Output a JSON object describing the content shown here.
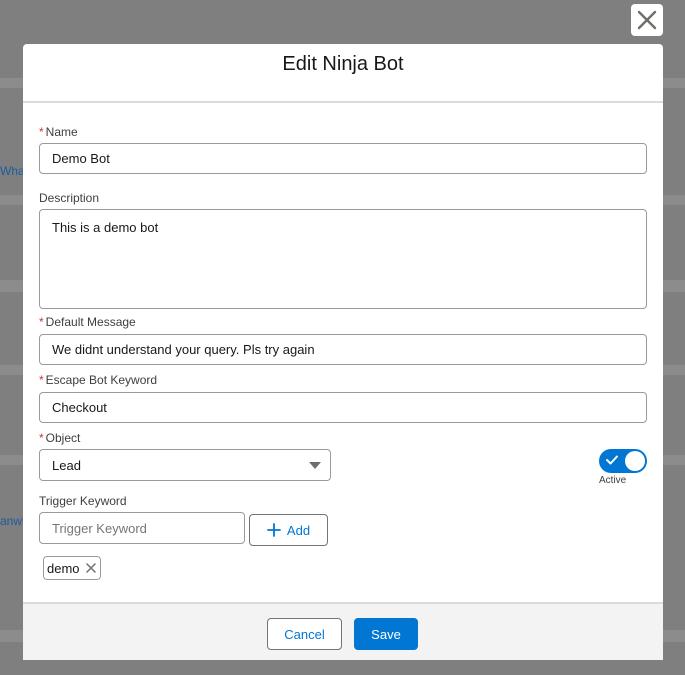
{
  "background": {
    "link_1": "Wha",
    "link_2": "anwh"
  },
  "modal": {
    "title": "Edit Ninja Bot",
    "close_icon": "close-icon"
  },
  "form": {
    "name": {
      "label": "Name",
      "value": "Demo Bot",
      "required": "*"
    },
    "description": {
      "label": "Description",
      "value": "This is a demo bot"
    },
    "default_message": {
      "label": "Default Message",
      "value": "We didnt understand your query. Pls try again",
      "required": "*"
    },
    "escape_keyword": {
      "label": "Escape Bot Keyword",
      "value": "Checkout",
      "required": "*"
    },
    "object": {
      "label": "Object",
      "value": "Lead",
      "required": "*"
    },
    "active": {
      "label": "Active",
      "checked": true
    },
    "trigger_keyword": {
      "label": "Trigger Keyword",
      "placeholder": "Trigger Keyword",
      "add_label": "Add"
    },
    "keywords": [
      "demo"
    ]
  },
  "footer": {
    "cancel_label": "Cancel",
    "save_label": "Save"
  },
  "colors": {
    "brand": "#0176d3",
    "required": "#c23934",
    "overlay": "#7f7f7f"
  }
}
